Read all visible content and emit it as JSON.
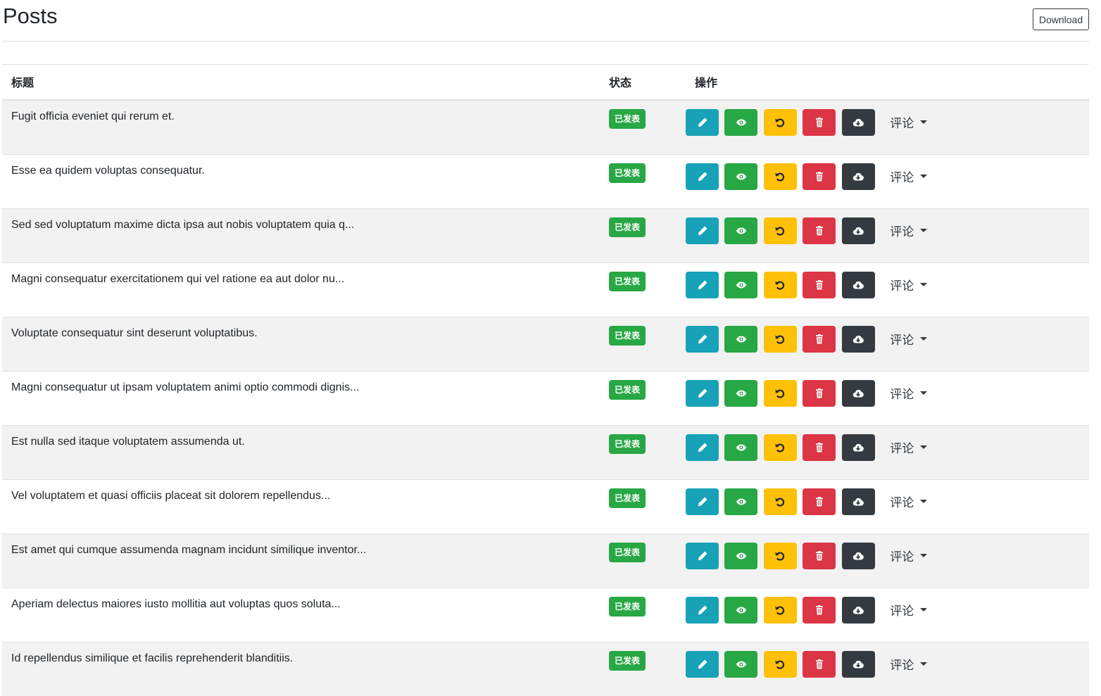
{
  "page": {
    "title": "Posts",
    "download_label": "Download"
  },
  "table": {
    "headers": {
      "title": "标题",
      "status": "状态",
      "actions": "操作"
    },
    "comment_label": "评论",
    "rows": [
      {
        "title": "Fugit officia eveniet qui rerum et.",
        "status": "已发表"
      },
      {
        "title": "Esse ea quidem voluptas consequatur.",
        "status": "已发表"
      },
      {
        "title": "Sed sed voluptatum maxime dicta ipsa aut nobis voluptatem quia q...",
        "status": "已发表"
      },
      {
        "title": "Magni consequatur exercitationem qui vel ratione ea aut dolor nu...",
        "status": "已发表"
      },
      {
        "title": "Voluptate consequatur sint deserunt voluptatibus.",
        "status": "已发表"
      },
      {
        "title": "Magni consequatur ut ipsam voluptatem animi optio commodi dignis...",
        "status": "已发表"
      },
      {
        "title": "Est nulla sed itaque voluptatem assumenda ut.",
        "status": "已发表"
      },
      {
        "title": "Vel voluptatem et quasi officiis placeat sit dolorem repellendus...",
        "status": "已发表"
      },
      {
        "title": "Est amet qui cumque assumenda magnam incidunt similique inventor...",
        "status": "已发表"
      },
      {
        "title": "Aperiam delectus maiores iusto mollitia aut voluptas quos soluta...",
        "status": "已发表"
      },
      {
        "title": "Id repellendus similique et facilis reprehenderit blanditiis.",
        "status": "已发表"
      }
    ],
    "action_icons": [
      "pencil-icon",
      "eye-icon",
      "undo-icon",
      "trash-icon",
      "cloud-download-icon"
    ]
  },
  "colors": {
    "edit": "#17a2b8",
    "view": "#28a745",
    "reset": "#ffc107",
    "delete": "#dc3545",
    "download": "#343a40",
    "badge": "#28a745",
    "striped_row": "#f2f2f2"
  }
}
